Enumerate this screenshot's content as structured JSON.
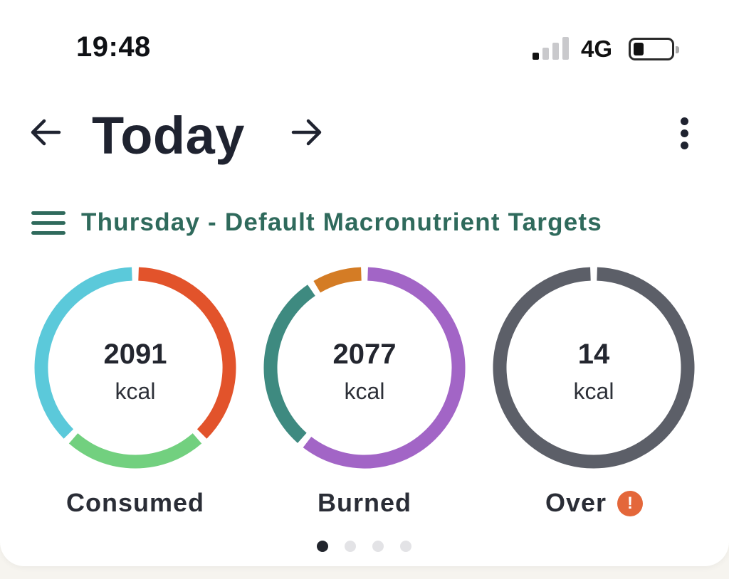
{
  "status_bar": {
    "time": "19:48",
    "network": "4G"
  },
  "header": {
    "title": "Today",
    "prev_icon": "arrow-left-icon",
    "next_icon": "arrow-right-icon",
    "more_icon": "vertical-dots-icon"
  },
  "targets": {
    "menu_icon": "hamburger-icon",
    "label": "Thursday - Default Macronutrient Targets"
  },
  "rings": [
    {
      "value": "2091",
      "unit": "kcal",
      "label": "Consumed",
      "segments": [
        {
          "share": 0.38,
          "color": "#e2532b"
        },
        {
          "share": 0.24,
          "color": "#72d07f"
        },
        {
          "share": 0.38,
          "color": "#5bc9da"
        }
      ]
    },
    {
      "value": "2077",
      "unit": "kcal",
      "label": "Burned",
      "segments": [
        {
          "share": 0.61,
          "color": "#a265c6"
        },
        {
          "share": 0.3,
          "color": "#3e8a80"
        },
        {
          "share": 0.09,
          "color": "#d47c25"
        }
      ]
    },
    {
      "value": "14",
      "unit": "kcal",
      "label": "Over",
      "segments": [
        {
          "share": 1.0,
          "color": "#5c5f68"
        }
      ]
    }
  ],
  "alert_icon": "exclamation-circle-icon",
  "alert_symbol": "!",
  "pager": {
    "count": 4,
    "active": 0
  }
}
